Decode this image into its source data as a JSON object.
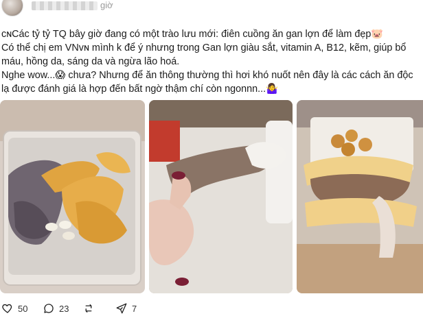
{
  "header": {
    "time_label": "giờ"
  },
  "post": {
    "paragraphs": [
      "ᴄɴCác tỷ tỷ TQ bây giờ đang có một trào lưu mới: điên cuồng ăn gan lợn để làm đẹp🐷",
      "Có thể chị em VNᴠɴ mình k để ý nhưng trong Gan lợn giàu sắt, vitamin A, B12, kẽm, giúp bổ máu, hồng da, sáng da và ngừa lão hoá.",
      "Nghe wow...😱 chưa? Nhưng để ăn thông thường thì hơi khó nuốt nên đây là các cách ăn độc lạ được đánh giá là hợp đến bất ngờ thậm chí còn ngonnn...🤷‍♀️"
    ]
  },
  "photos": {
    "photo1_icon": "liver-with-chips-photo",
    "photo2_icon": "liver-with-cream-photo",
    "photo3_icon": "liver-cracker-sandwich-photo"
  },
  "actions": {
    "like_count": "50",
    "reply_count": "23",
    "repost_count": "",
    "share_count": "7"
  }
}
